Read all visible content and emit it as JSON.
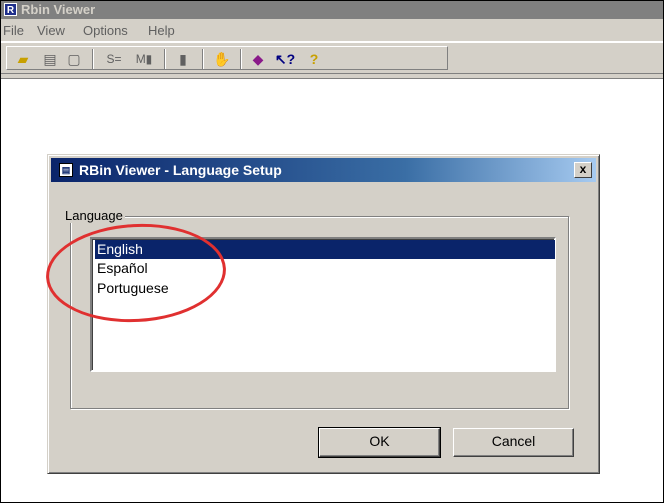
{
  "app": {
    "title": "Rbin Viewer",
    "icon_letter": "R"
  },
  "menu": [
    "File",
    "View",
    "Options",
    "Help"
  ],
  "toolbar": {
    "icons": [
      "open-folder-icon",
      "print-icon",
      "print-preview-icon",
      "scroll-icon",
      "menu-icon",
      "file-icon",
      "hand-icon",
      "book-icon",
      "whats-this-icon",
      "help-icon"
    ]
  },
  "dialog": {
    "title": "RBin Viewer - Language Setup",
    "close_label": "x",
    "group_label": "Language",
    "languages": [
      "English",
      "Español",
      "Portuguese"
    ],
    "selected_index": 0,
    "ok_label": "OK",
    "cancel_label": "Cancel"
  },
  "colors": {
    "selection": "#0a246a",
    "annotation": "#e03030"
  }
}
